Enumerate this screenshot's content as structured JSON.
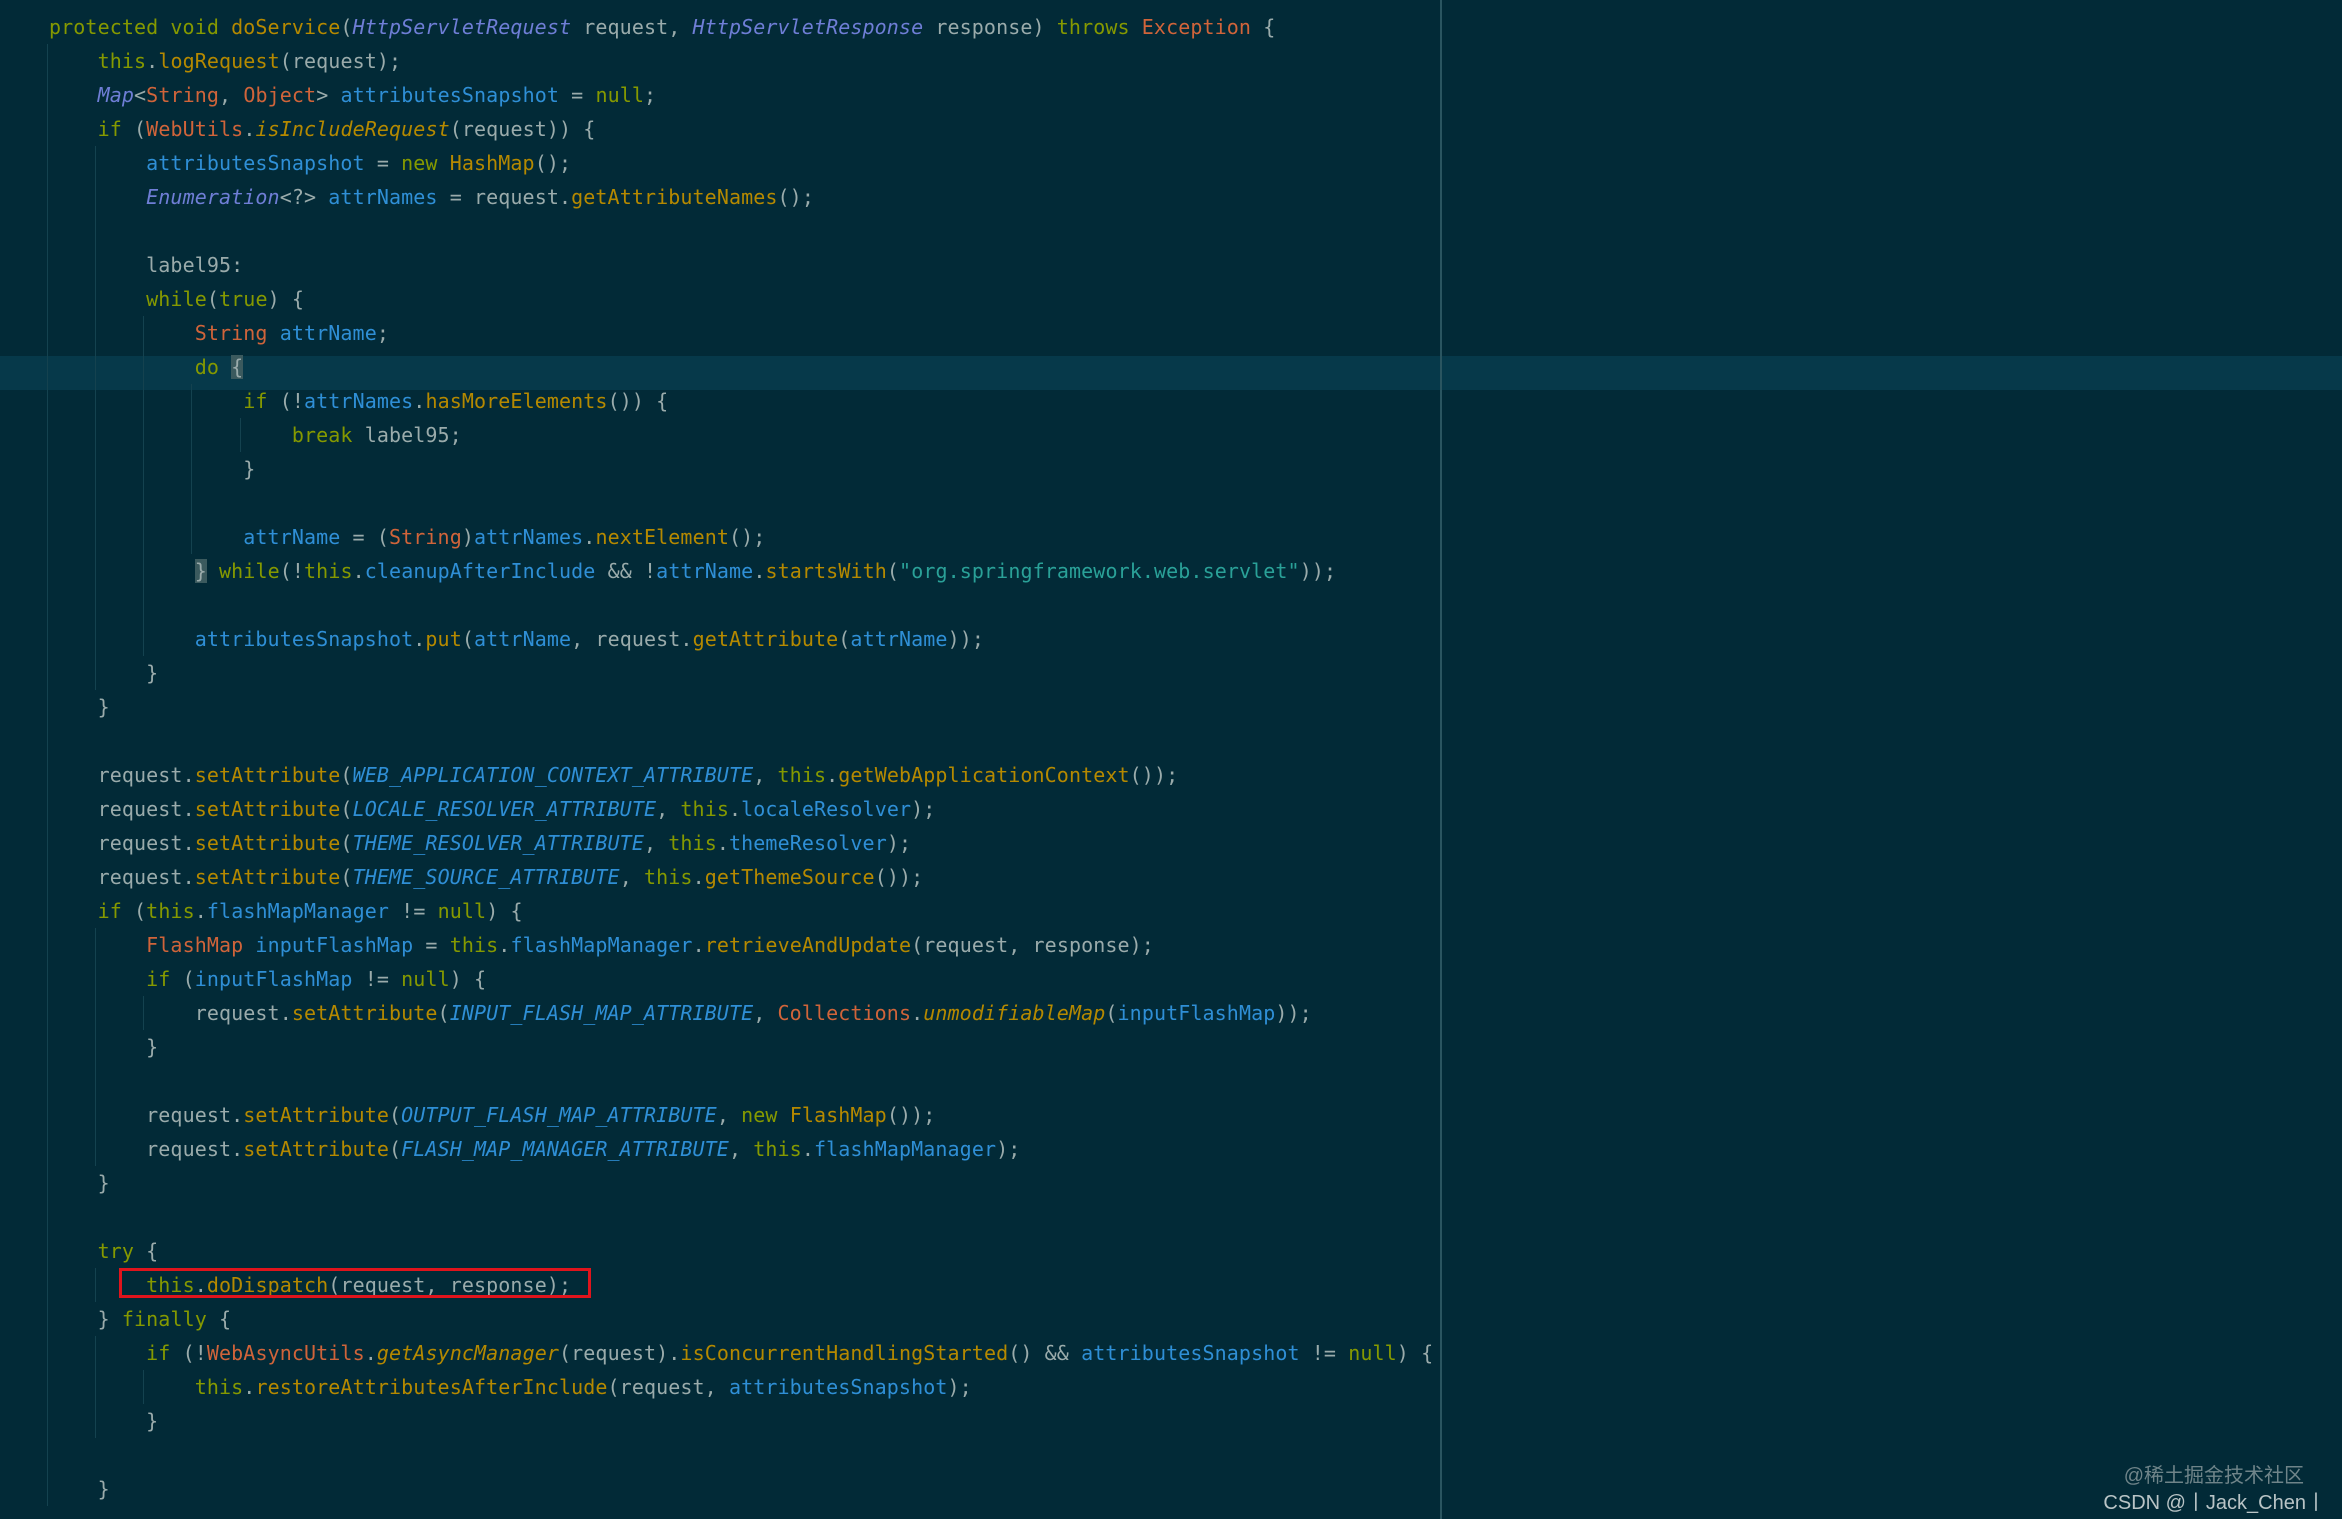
{
  "editor": {
    "theme_colors": {
      "background": "#022a37",
      "current_line": "#06394a",
      "keyword": "#859900",
      "method": "#b58900",
      "type": "#d0643a",
      "interface": "#6f7ed6",
      "field": "#2f8fd6",
      "string": "#2aa198",
      "plain": "#9aabab",
      "highlight_box": "#e0141c"
    },
    "current_line_number": 11,
    "highlighted_line_number": 38,
    "lines": [
      {
        "indent": 0,
        "tokens": [
          [
            "kw",
            "protected void "
          ],
          [
            "mt",
            "doService"
          ],
          [
            "pl",
            "("
          ],
          [
            "it",
            "HttpServletRequest"
          ],
          [
            "pl",
            " request, "
          ],
          [
            "it",
            "HttpServletResponse"
          ],
          [
            "pl",
            " response) "
          ],
          [
            "kw",
            "throws "
          ],
          [
            "ty",
            "Exception"
          ],
          [
            "pl",
            " {"
          ]
        ]
      },
      {
        "indent": 1,
        "tokens": [
          [
            "kw",
            "this"
          ],
          [
            "pl",
            "."
          ],
          [
            "mt",
            "logRequest"
          ],
          [
            "pl",
            "(request);"
          ]
        ]
      },
      {
        "indent": 1,
        "tokens": [
          [
            "it",
            "Map"
          ],
          [
            "pl",
            "<"
          ],
          [
            "ty",
            "String"
          ],
          [
            "pl",
            ", "
          ],
          [
            "ty",
            "Object"
          ],
          [
            "pl",
            "> "
          ],
          [
            "fd",
            "attributesSnapshot"
          ],
          [
            "pl",
            " = "
          ],
          [
            "kw",
            "null"
          ],
          [
            "pl",
            ";"
          ]
        ]
      },
      {
        "indent": 1,
        "tokens": [
          [
            "kw",
            "if "
          ],
          [
            "pl",
            "("
          ],
          [
            "ty",
            "WebUtils"
          ],
          [
            "pl",
            "."
          ],
          [
            "sm",
            "isIncludeRequest"
          ],
          [
            "pl",
            "(request)) {"
          ]
        ]
      },
      {
        "indent": 2,
        "tokens": [
          [
            "fd",
            "attributesSnapshot"
          ],
          [
            "pl",
            " = "
          ],
          [
            "kw",
            "new "
          ],
          [
            "mt",
            "HashMap"
          ],
          [
            "pl",
            "();"
          ]
        ]
      },
      {
        "indent": 2,
        "tokens": [
          [
            "it",
            "Enumeration"
          ],
          [
            "pl",
            "<?> "
          ],
          [
            "fd",
            "attrNames"
          ],
          [
            "pl",
            " = request."
          ],
          [
            "mt",
            "getAttributeNames"
          ],
          [
            "pl",
            "();"
          ]
        ]
      },
      {
        "indent": 0,
        "tokens": []
      },
      {
        "indent": 2,
        "tokens": [
          [
            "pl",
            "label95:"
          ]
        ]
      },
      {
        "indent": 2,
        "tokens": [
          [
            "kw",
            "while"
          ],
          [
            "pl",
            "("
          ],
          [
            "kw",
            "true"
          ],
          [
            "pl",
            ") {"
          ]
        ]
      },
      {
        "indent": 3,
        "tokens": [
          [
            "ty",
            "String "
          ],
          [
            "fd",
            "attrName"
          ],
          [
            "pl",
            ";"
          ]
        ]
      },
      {
        "indent": 3,
        "tokens": [
          [
            "kw",
            "do "
          ],
          [
            "br",
            "{"
          ]
        ]
      },
      {
        "indent": 4,
        "tokens": [
          [
            "kw",
            "if "
          ],
          [
            "pl",
            "(!"
          ],
          [
            "fd",
            "attrNames"
          ],
          [
            "pl",
            "."
          ],
          [
            "mt",
            "hasMoreElements"
          ],
          [
            "pl",
            "()) {"
          ]
        ]
      },
      {
        "indent": 5,
        "tokens": [
          [
            "kw",
            "break "
          ],
          [
            "pl",
            "label95;"
          ]
        ]
      },
      {
        "indent": 4,
        "tokens": [
          [
            "pl",
            "}"
          ]
        ]
      },
      {
        "indent": 0,
        "tokens": []
      },
      {
        "indent": 4,
        "tokens": [
          [
            "fd",
            "attrName"
          ],
          [
            "pl",
            " = ("
          ],
          [
            "ty",
            "String"
          ],
          [
            "pl",
            ")"
          ],
          [
            "fd",
            "attrNames"
          ],
          [
            "pl",
            "."
          ],
          [
            "mt",
            "nextElement"
          ],
          [
            "pl",
            "();"
          ]
        ]
      },
      {
        "indent": 3,
        "tokens": [
          [
            "br",
            "}"
          ],
          [
            "pl",
            " "
          ],
          [
            "kw",
            "while"
          ],
          [
            "pl",
            "(!"
          ],
          [
            "kw",
            "this"
          ],
          [
            "pl",
            "."
          ],
          [
            "fd",
            "cleanupAfterInclude"
          ],
          [
            "pl",
            " && !"
          ],
          [
            "fd",
            "attrName"
          ],
          [
            "pl",
            "."
          ],
          [
            "mt",
            "startsWith"
          ],
          [
            "pl",
            "("
          ],
          [
            "st",
            "\"org.springframework.web.servlet\""
          ],
          [
            "pl",
            "));"
          ]
        ]
      },
      {
        "indent": 0,
        "tokens": []
      },
      {
        "indent": 3,
        "tokens": [
          [
            "fd",
            "attributesSnapshot"
          ],
          [
            "pl",
            "."
          ],
          [
            "mt",
            "put"
          ],
          [
            "pl",
            "("
          ],
          [
            "fd",
            "attrName"
          ],
          [
            "pl",
            ", request."
          ],
          [
            "mt",
            "getAttribute"
          ],
          [
            "pl",
            "("
          ],
          [
            "fd",
            "attrName"
          ],
          [
            "pl",
            "));"
          ]
        ]
      },
      {
        "indent": 2,
        "tokens": [
          [
            "pl",
            "}"
          ]
        ]
      },
      {
        "indent": 1,
        "tokens": [
          [
            "pl",
            "}"
          ]
        ]
      },
      {
        "indent": 0,
        "tokens": []
      },
      {
        "indent": 1,
        "tokens": [
          [
            "pl",
            "request."
          ],
          [
            "mt",
            "setAttribute"
          ],
          [
            "pl",
            "("
          ],
          [
            "cn",
            "WEB_APPLICATION_CONTEXT_ATTRIBUTE"
          ],
          [
            "pl",
            ", "
          ],
          [
            "kw",
            "this"
          ],
          [
            "pl",
            "."
          ],
          [
            "mt",
            "getWebApplicationContext"
          ],
          [
            "pl",
            "());"
          ]
        ]
      },
      {
        "indent": 1,
        "tokens": [
          [
            "pl",
            "request."
          ],
          [
            "mt",
            "setAttribute"
          ],
          [
            "pl",
            "("
          ],
          [
            "cn",
            "LOCALE_RESOLVER_ATTRIBUTE"
          ],
          [
            "pl",
            ", "
          ],
          [
            "kw",
            "this"
          ],
          [
            "pl",
            "."
          ],
          [
            "fd",
            "localeResolver"
          ],
          [
            "pl",
            ");"
          ]
        ]
      },
      {
        "indent": 1,
        "tokens": [
          [
            "pl",
            "request."
          ],
          [
            "mt",
            "setAttribute"
          ],
          [
            "pl",
            "("
          ],
          [
            "cn",
            "THEME_RESOLVER_ATTRIBUTE"
          ],
          [
            "pl",
            ", "
          ],
          [
            "kw",
            "this"
          ],
          [
            "pl",
            "."
          ],
          [
            "fd",
            "themeResolver"
          ],
          [
            "pl",
            ");"
          ]
        ]
      },
      {
        "indent": 1,
        "tokens": [
          [
            "pl",
            "request."
          ],
          [
            "mt",
            "setAttribute"
          ],
          [
            "pl",
            "("
          ],
          [
            "cn",
            "THEME_SOURCE_ATTRIBUTE"
          ],
          [
            "pl",
            ", "
          ],
          [
            "kw",
            "this"
          ],
          [
            "pl",
            "."
          ],
          [
            "mt",
            "getThemeSource"
          ],
          [
            "pl",
            "());"
          ]
        ]
      },
      {
        "indent": 1,
        "tokens": [
          [
            "kw",
            "if "
          ],
          [
            "pl",
            "("
          ],
          [
            "kw",
            "this"
          ],
          [
            "pl",
            "."
          ],
          [
            "fd",
            "flashMapManager"
          ],
          [
            "pl",
            " != "
          ],
          [
            "kw",
            "null"
          ],
          [
            "pl",
            ") {"
          ]
        ]
      },
      {
        "indent": 2,
        "tokens": [
          [
            "ty",
            "FlashMap "
          ],
          [
            "fd",
            "inputFlashMap"
          ],
          [
            "pl",
            " = "
          ],
          [
            "kw",
            "this"
          ],
          [
            "pl",
            "."
          ],
          [
            "fd",
            "flashMapManager"
          ],
          [
            "pl",
            "."
          ],
          [
            "mt",
            "retrieveAndUpdate"
          ],
          [
            "pl",
            "(request, response);"
          ]
        ]
      },
      {
        "indent": 2,
        "tokens": [
          [
            "kw",
            "if "
          ],
          [
            "pl",
            "("
          ],
          [
            "fd",
            "inputFlashMap"
          ],
          [
            "pl",
            " != "
          ],
          [
            "kw",
            "null"
          ],
          [
            "pl",
            ") {"
          ]
        ]
      },
      {
        "indent": 3,
        "tokens": [
          [
            "pl",
            "request."
          ],
          [
            "mt",
            "setAttribute"
          ],
          [
            "pl",
            "("
          ],
          [
            "cn",
            "INPUT_FLASH_MAP_ATTRIBUTE"
          ],
          [
            "pl",
            ", "
          ],
          [
            "ty",
            "Collections"
          ],
          [
            "pl",
            "."
          ],
          [
            "sm",
            "unmodifiableMap"
          ],
          [
            "pl",
            "("
          ],
          [
            "fd",
            "inputFlashMap"
          ],
          [
            "pl",
            "));"
          ]
        ]
      },
      {
        "indent": 2,
        "tokens": [
          [
            "pl",
            "}"
          ]
        ]
      },
      {
        "indent": 0,
        "tokens": []
      },
      {
        "indent": 2,
        "tokens": [
          [
            "pl",
            "request."
          ],
          [
            "mt",
            "setAttribute"
          ],
          [
            "pl",
            "("
          ],
          [
            "cn",
            "OUTPUT_FLASH_MAP_ATTRIBUTE"
          ],
          [
            "pl",
            ", "
          ],
          [
            "kw",
            "new "
          ],
          [
            "mt",
            "FlashMap"
          ],
          [
            "pl",
            "());"
          ]
        ]
      },
      {
        "indent": 2,
        "tokens": [
          [
            "pl",
            "request."
          ],
          [
            "mt",
            "setAttribute"
          ],
          [
            "pl",
            "("
          ],
          [
            "cn",
            "FLASH_MAP_MANAGER_ATTRIBUTE"
          ],
          [
            "pl",
            ", "
          ],
          [
            "kw",
            "this"
          ],
          [
            "pl",
            "."
          ],
          [
            "fd",
            "flashMapManager"
          ],
          [
            "pl",
            ");"
          ]
        ]
      },
      {
        "indent": 1,
        "tokens": [
          [
            "pl",
            "}"
          ]
        ]
      },
      {
        "indent": 0,
        "tokens": []
      },
      {
        "indent": 1,
        "tokens": [
          [
            "kw",
            "try "
          ],
          [
            "pl",
            "{"
          ]
        ]
      },
      {
        "indent": 2,
        "tokens": [
          [
            "kw",
            "this"
          ],
          [
            "pl",
            "."
          ],
          [
            "mt",
            "doDispatch"
          ],
          [
            "pl",
            "(request, response);"
          ]
        ]
      },
      {
        "indent": 1,
        "tokens": [
          [
            "pl",
            "} "
          ],
          [
            "kw",
            "finally "
          ],
          [
            "pl",
            "{"
          ]
        ]
      },
      {
        "indent": 2,
        "tokens": [
          [
            "kw",
            "if "
          ],
          [
            "pl",
            "(!"
          ],
          [
            "ty",
            "WebAsyncUtils"
          ],
          [
            "pl",
            "."
          ],
          [
            "sm",
            "getAsyncManager"
          ],
          [
            "pl",
            "(request)."
          ],
          [
            "mt",
            "isConcurrentHandlingStarted"
          ],
          [
            "pl",
            "() && "
          ],
          [
            "fd",
            "attributesSnapshot"
          ],
          [
            "pl",
            " != "
          ],
          [
            "kw",
            "null"
          ],
          [
            "pl",
            ") {"
          ]
        ]
      },
      {
        "indent": 3,
        "tokens": [
          [
            "kw",
            "this"
          ],
          [
            "pl",
            "."
          ],
          [
            "mt",
            "restoreAttributesAfterInclude"
          ],
          [
            "pl",
            "(request, "
          ],
          [
            "fd",
            "attributesSnapshot"
          ],
          [
            "pl",
            ");"
          ]
        ]
      },
      {
        "indent": 2,
        "tokens": [
          [
            "pl",
            "}"
          ]
        ]
      },
      {
        "indent": 0,
        "tokens": []
      },
      {
        "indent": 1,
        "tokens": [
          [
            "pl",
            "}"
          ]
        ]
      }
    ]
  },
  "watermark": {
    "line1": "@稀土掘金技术社区",
    "line2": "CSDN @丨Jack_Chen丨"
  }
}
